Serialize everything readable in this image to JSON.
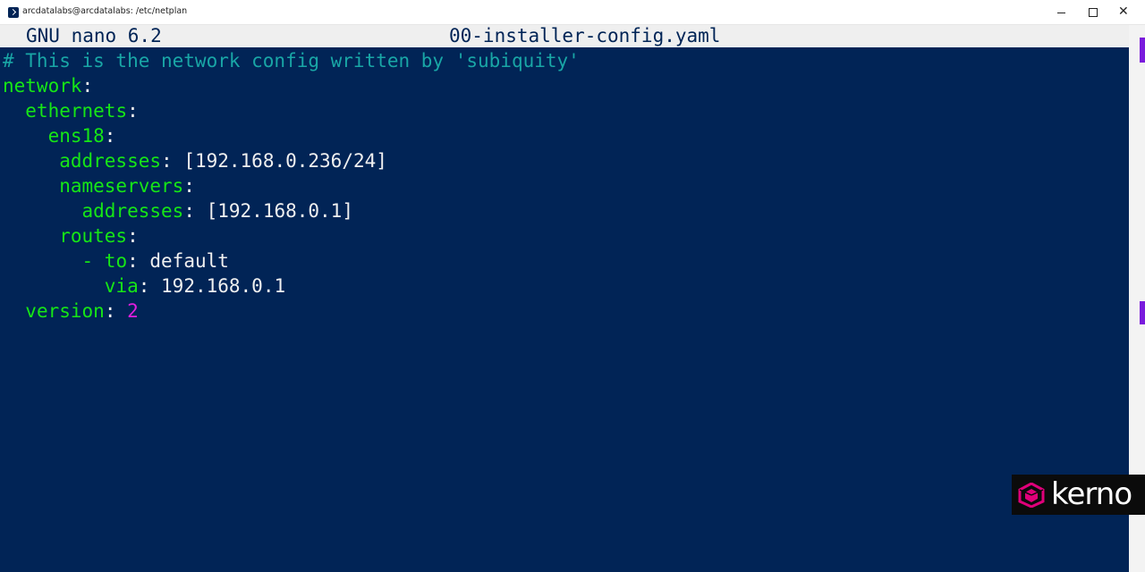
{
  "window": {
    "title": "arcdatalabs@arcdatalabs: /etc/netplan",
    "icon": "powershell-icon"
  },
  "nano": {
    "version": "GNU nano 6.2",
    "filename": "00-installer-config.yaml"
  },
  "file_lines": [
    {
      "comment": "# This is the network config written by 'subiquity'"
    },
    {
      "key": "network",
      "punct": ":"
    },
    {
      "indent": "  ",
      "key": "ethernets",
      "punct": ":"
    },
    {
      "indent": "    ",
      "key": "ens18",
      "punct": ":"
    },
    {
      "indent": "     ",
      "key": "addresses",
      "punct": ":",
      "value": " [192.168.0.236/24]"
    },
    {
      "indent": "     ",
      "key": "nameservers",
      "punct": ":"
    },
    {
      "indent": "       ",
      "key": "addresses",
      "punct": ":",
      "value": " [192.168.0.1]"
    },
    {
      "indent": "     ",
      "key": "routes",
      "punct": ":"
    },
    {
      "indent": "       ",
      "key": "- to",
      "punct": ":",
      "value": " default"
    },
    {
      "indent": "         ",
      "key": "via",
      "punct": ":",
      "value": " 192.168.0.1"
    },
    {
      "indent": "  ",
      "key": "version",
      "punct": ": ",
      "number": "2"
    }
  ],
  "watermark": {
    "brand": "kerno"
  },
  "colors": {
    "terminal_bg": "#012456",
    "yaml_key": "#16e616",
    "comment": "#19a6a6",
    "number": "#e21ee0",
    "logo_magenta": "#e0007a"
  }
}
